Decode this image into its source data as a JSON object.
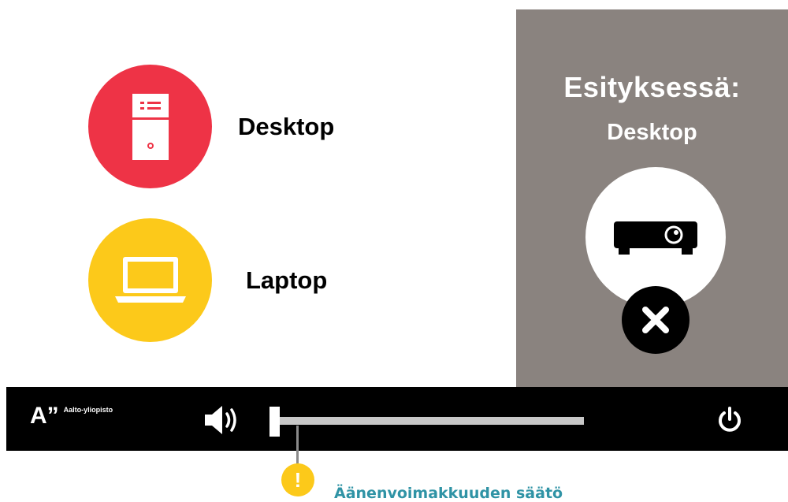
{
  "sources": {
    "desktop": {
      "label": "Desktop",
      "color": "#ee3346",
      "icon": "desktop-tower-icon"
    },
    "laptop": {
      "label": "Laptop",
      "color": "#fcc91a",
      "icon": "laptop-icon"
    }
  },
  "presenting": {
    "title": "Esityksessä:",
    "source": "Desktop",
    "icon": "projector-icon",
    "stop_icon": "close-icon",
    "panel_color": "#8a837f"
  },
  "bottombar": {
    "logo_mark": "A”",
    "logo_text": "Aalto-yliopisto",
    "volume_icon": "speaker-icon",
    "volume_level": 0.0,
    "power_icon": "power-icon"
  },
  "callout": {
    "mark": "!",
    "text": "Äänenvoimakkuuden säätö",
    "color": "#2f93a5"
  }
}
